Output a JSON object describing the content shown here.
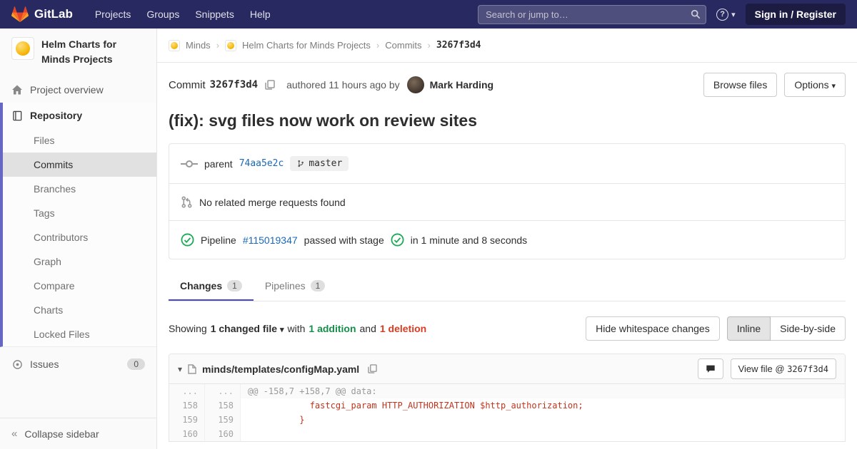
{
  "colors": {
    "navbar": "#292961",
    "accent": "#4b4ba8",
    "link": "#1b69b6",
    "success": "#1aaa55",
    "danger": "#db3b21"
  },
  "navbar": {
    "brand": "GitLab",
    "menu": [
      "Projects",
      "Groups",
      "Snippets",
      "Help"
    ],
    "search_placeholder": "Search or jump to…",
    "sign_in": "Sign in / Register"
  },
  "sidebar": {
    "project_title": "Helm Charts for Minds Projects",
    "items": {
      "overview": "Project overview",
      "repository": "Repository",
      "issues": "Issues"
    },
    "issues_count": "0",
    "repo_subitems": [
      "Files",
      "Commits",
      "Branches",
      "Tags",
      "Contributors",
      "Graph",
      "Compare",
      "Charts",
      "Locked Files"
    ],
    "collapse_label": "Collapse sidebar"
  },
  "breadcrumb": {
    "items": [
      "Minds",
      "Helm Charts for Minds Projects",
      "Commits"
    ],
    "current": "3267f3d4"
  },
  "commit": {
    "label": "Commit",
    "sha": "3267f3d4",
    "authored": "authored 11 hours ago by",
    "author": "Mark Harding",
    "browse_files": "Browse files",
    "options": "Options",
    "title": "(fix): svg files now work on review sites",
    "parent_label": "parent",
    "parent_sha": "74aa5e2c",
    "branch": "master",
    "no_mr": "No related merge requests found",
    "pipeline_prefix": "Pipeline",
    "pipeline_id": "#115019347",
    "pipeline_mid": "passed with stage",
    "pipeline_suffix": "in 1 minute and 8 seconds"
  },
  "tabs": [
    {
      "label": "Changes",
      "count": "1"
    },
    {
      "label": "Pipelines",
      "count": "1"
    }
  ],
  "summary": {
    "showing": "Showing",
    "changed_file": "1 changed file",
    "with": "with",
    "additions": "1 addition",
    "and": "and",
    "deletions": "1 deletion",
    "hide_whitespace": "Hide whitespace changes",
    "inline": "Inline",
    "side_by_side": "Side-by-side"
  },
  "diff": {
    "filename": "minds/templates/configMap.yaml",
    "view_file_label": "View file @",
    "view_file_sha": "3267f3d4",
    "hunk_dots": "...",
    "hunk": "@@ -158,7 +158,7 @@ data:",
    "lines": [
      {
        "old": "158",
        "new": "158",
        "code": "            fastcgi_param HTTP_AUTHORIZATION $http_authorization;"
      },
      {
        "old": "159",
        "new": "159",
        "code": "          }"
      },
      {
        "old": "160",
        "new": "160",
        "code": ""
      }
    ]
  }
}
